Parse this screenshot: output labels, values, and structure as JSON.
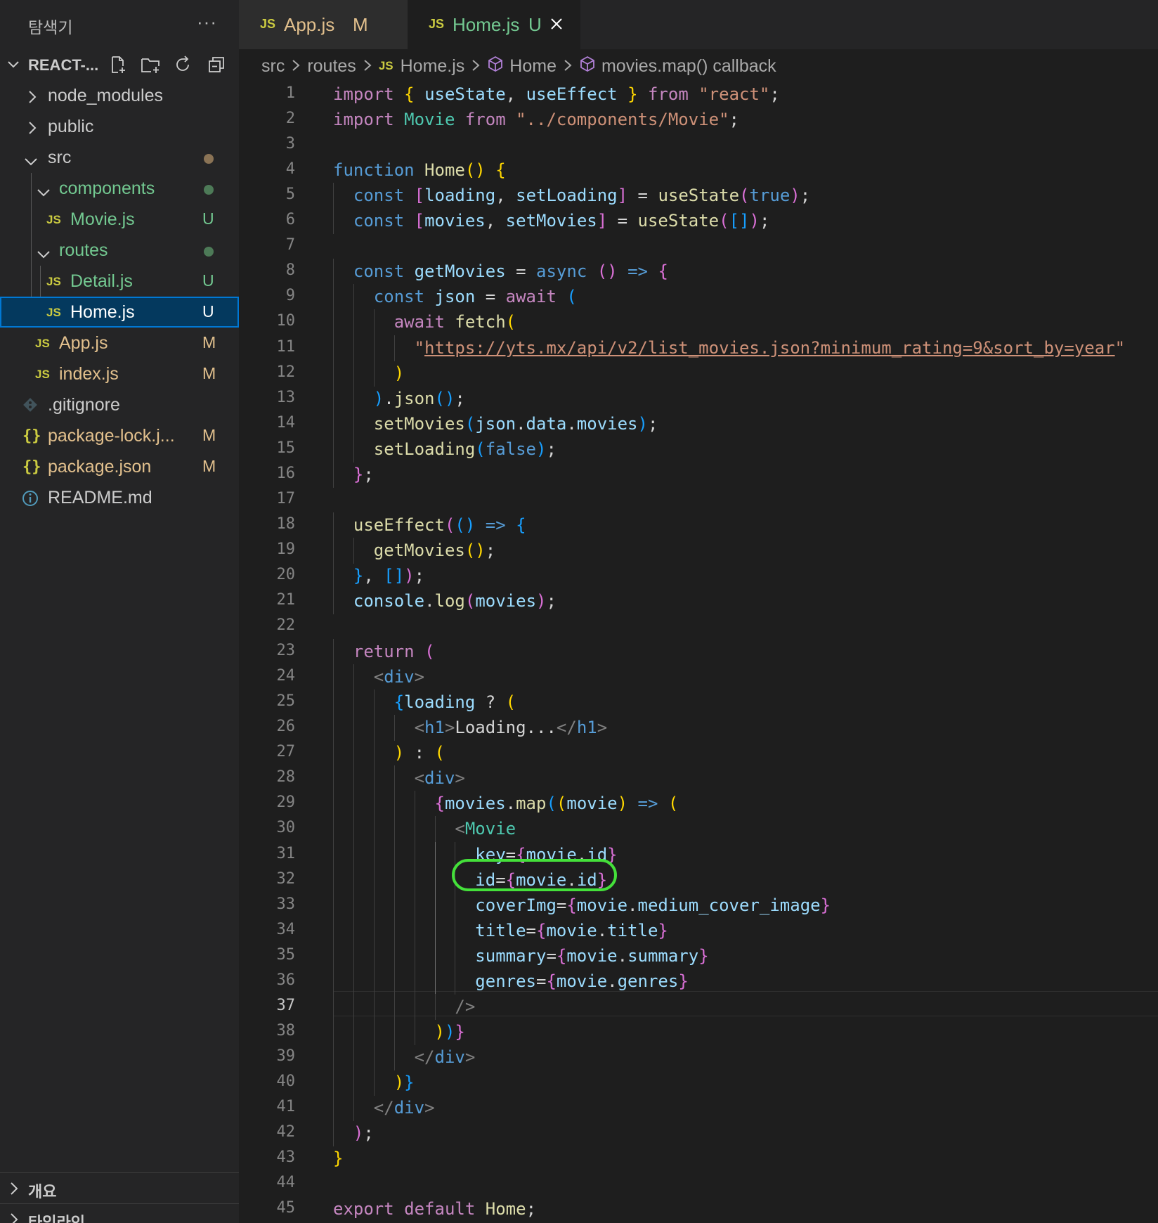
{
  "explorer": {
    "title": "탐색기",
    "more": "···",
    "root_label": "REACT-..."
  },
  "tree": [
    {
      "name": "node_modules",
      "kind": "folder",
      "open": false,
      "color": "#cccccc"
    },
    {
      "name": "public",
      "kind": "folder",
      "open": false,
      "color": "#cccccc"
    },
    {
      "name": "src",
      "kind": "folder",
      "open": true,
      "color": "#cccccc",
      "dot": "#8a7355"
    },
    {
      "name": "components",
      "kind": "folder",
      "open": true,
      "color": "#73c991",
      "dot": "#4d7a57"
    },
    {
      "name": "Movie.js",
      "kind": "js",
      "badge": "U",
      "color": "#73c991"
    },
    {
      "name": "routes",
      "kind": "folder",
      "open": true,
      "color": "#73c991",
      "dot": "#4d7a57"
    },
    {
      "name": "Detail.js",
      "kind": "js",
      "badge": "U",
      "color": "#73c991"
    },
    {
      "name": "Home.js",
      "kind": "js",
      "badge": "U",
      "color": "#ffffff",
      "selected": true
    },
    {
      "name": "App.js",
      "kind": "js",
      "badge": "M",
      "color": "#e2c08d"
    },
    {
      "name": "index.js",
      "kind": "js",
      "badge": "M",
      "color": "#e2c08d"
    },
    {
      "name": ".gitignore",
      "kind": "git",
      "color": "#cccccc"
    },
    {
      "name": "package-lock.j...",
      "kind": "json",
      "badge": "M",
      "color": "#e2c08d"
    },
    {
      "name": "package.json",
      "kind": "json",
      "badge": "M",
      "color": "#e2c08d"
    },
    {
      "name": "README.md",
      "kind": "info",
      "color": "#cccccc"
    }
  ],
  "bottom_panels": [
    "개요",
    "타임라인"
  ],
  "tabs": [
    {
      "icon": "JS",
      "name": "App.js",
      "status": "M",
      "active": false
    },
    {
      "icon": "JS",
      "name": "Home.js",
      "status": "U",
      "active": true
    }
  ],
  "breadcrumb": {
    "src": "src",
    "routes": "routes",
    "file": "Home.js",
    "symbol1": "Home",
    "symbol2": "movies.map() callback"
  },
  "editor": {
    "active_line": 37,
    "highlighted_line": 32,
    "lines": [
      "import { useState, useEffect } from \"react\";",
      "import Movie from \"../components/Movie\";",
      "",
      "function Home() {",
      "  const [loading, setLoading] = useState(true);",
      "  const [movies, setMovies] = useState([]);",
      "",
      "  const getMovies = async () => {",
      "    const json = await (",
      "      await fetch(",
      "        \"https://yts.mx/api/v2/list_movies.json?minimum_rating=9&sort_by=year\"",
      "      )",
      "    ).json();",
      "    setMovies(json.data.movies);",
      "    setLoading(false);",
      "  };",
      "",
      "  useEffect(() => {",
      "    getMovies();",
      "  }, []);",
      "  console.log(movies);",
      "",
      "  return (",
      "    <div>",
      "      {loading ? (",
      "        <h1>Loading...</h1>",
      "      ) : (",
      "        <div>",
      "          {movies.map((movie) => (",
      "            <Movie",
      "              key={movie.id}",
      "              id={movie.id}",
      "              coverImg={movie.medium_cover_image}",
      "              title={movie.title}",
      "              summary={movie.summary}",
      "              genres={movie.genres}",
      "            />",
      "          ))}",
      "        </div>",
      "      )}",
      "    </div>",
      "  );",
      "}",
      "",
      "export default Home;"
    ]
  }
}
